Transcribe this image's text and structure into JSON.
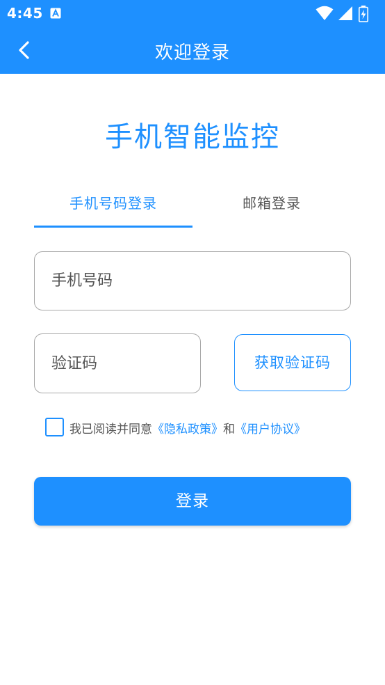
{
  "colors": {
    "primary": "#1e90ff",
    "text_dark": "#555555",
    "border": "#a8a8a8",
    "background": "#ffffff"
  },
  "status_bar": {
    "time": "4:45",
    "icons": [
      "app-notification-icon",
      "wifi-icon",
      "signal-icon",
      "battery-charging-icon"
    ]
  },
  "app_bar": {
    "back_icon": "chevron-left-icon",
    "title": "欢迎登录"
  },
  "brand": {
    "title": "手机智能监控"
  },
  "tabs": [
    {
      "label": "手机号码登录",
      "active": true
    },
    {
      "label": "邮箱登录",
      "active": false
    }
  ],
  "form": {
    "phone_placeholder": "手机号码",
    "code_placeholder": "验证码",
    "get_code_label": "获取验证码"
  },
  "agreement": {
    "checked": false,
    "prefix": "我已阅读并同意",
    "privacy_link": "《隐私政策》",
    "conjunction": "和",
    "terms_link": "《用户协议》"
  },
  "login_button": {
    "label": "登录"
  }
}
